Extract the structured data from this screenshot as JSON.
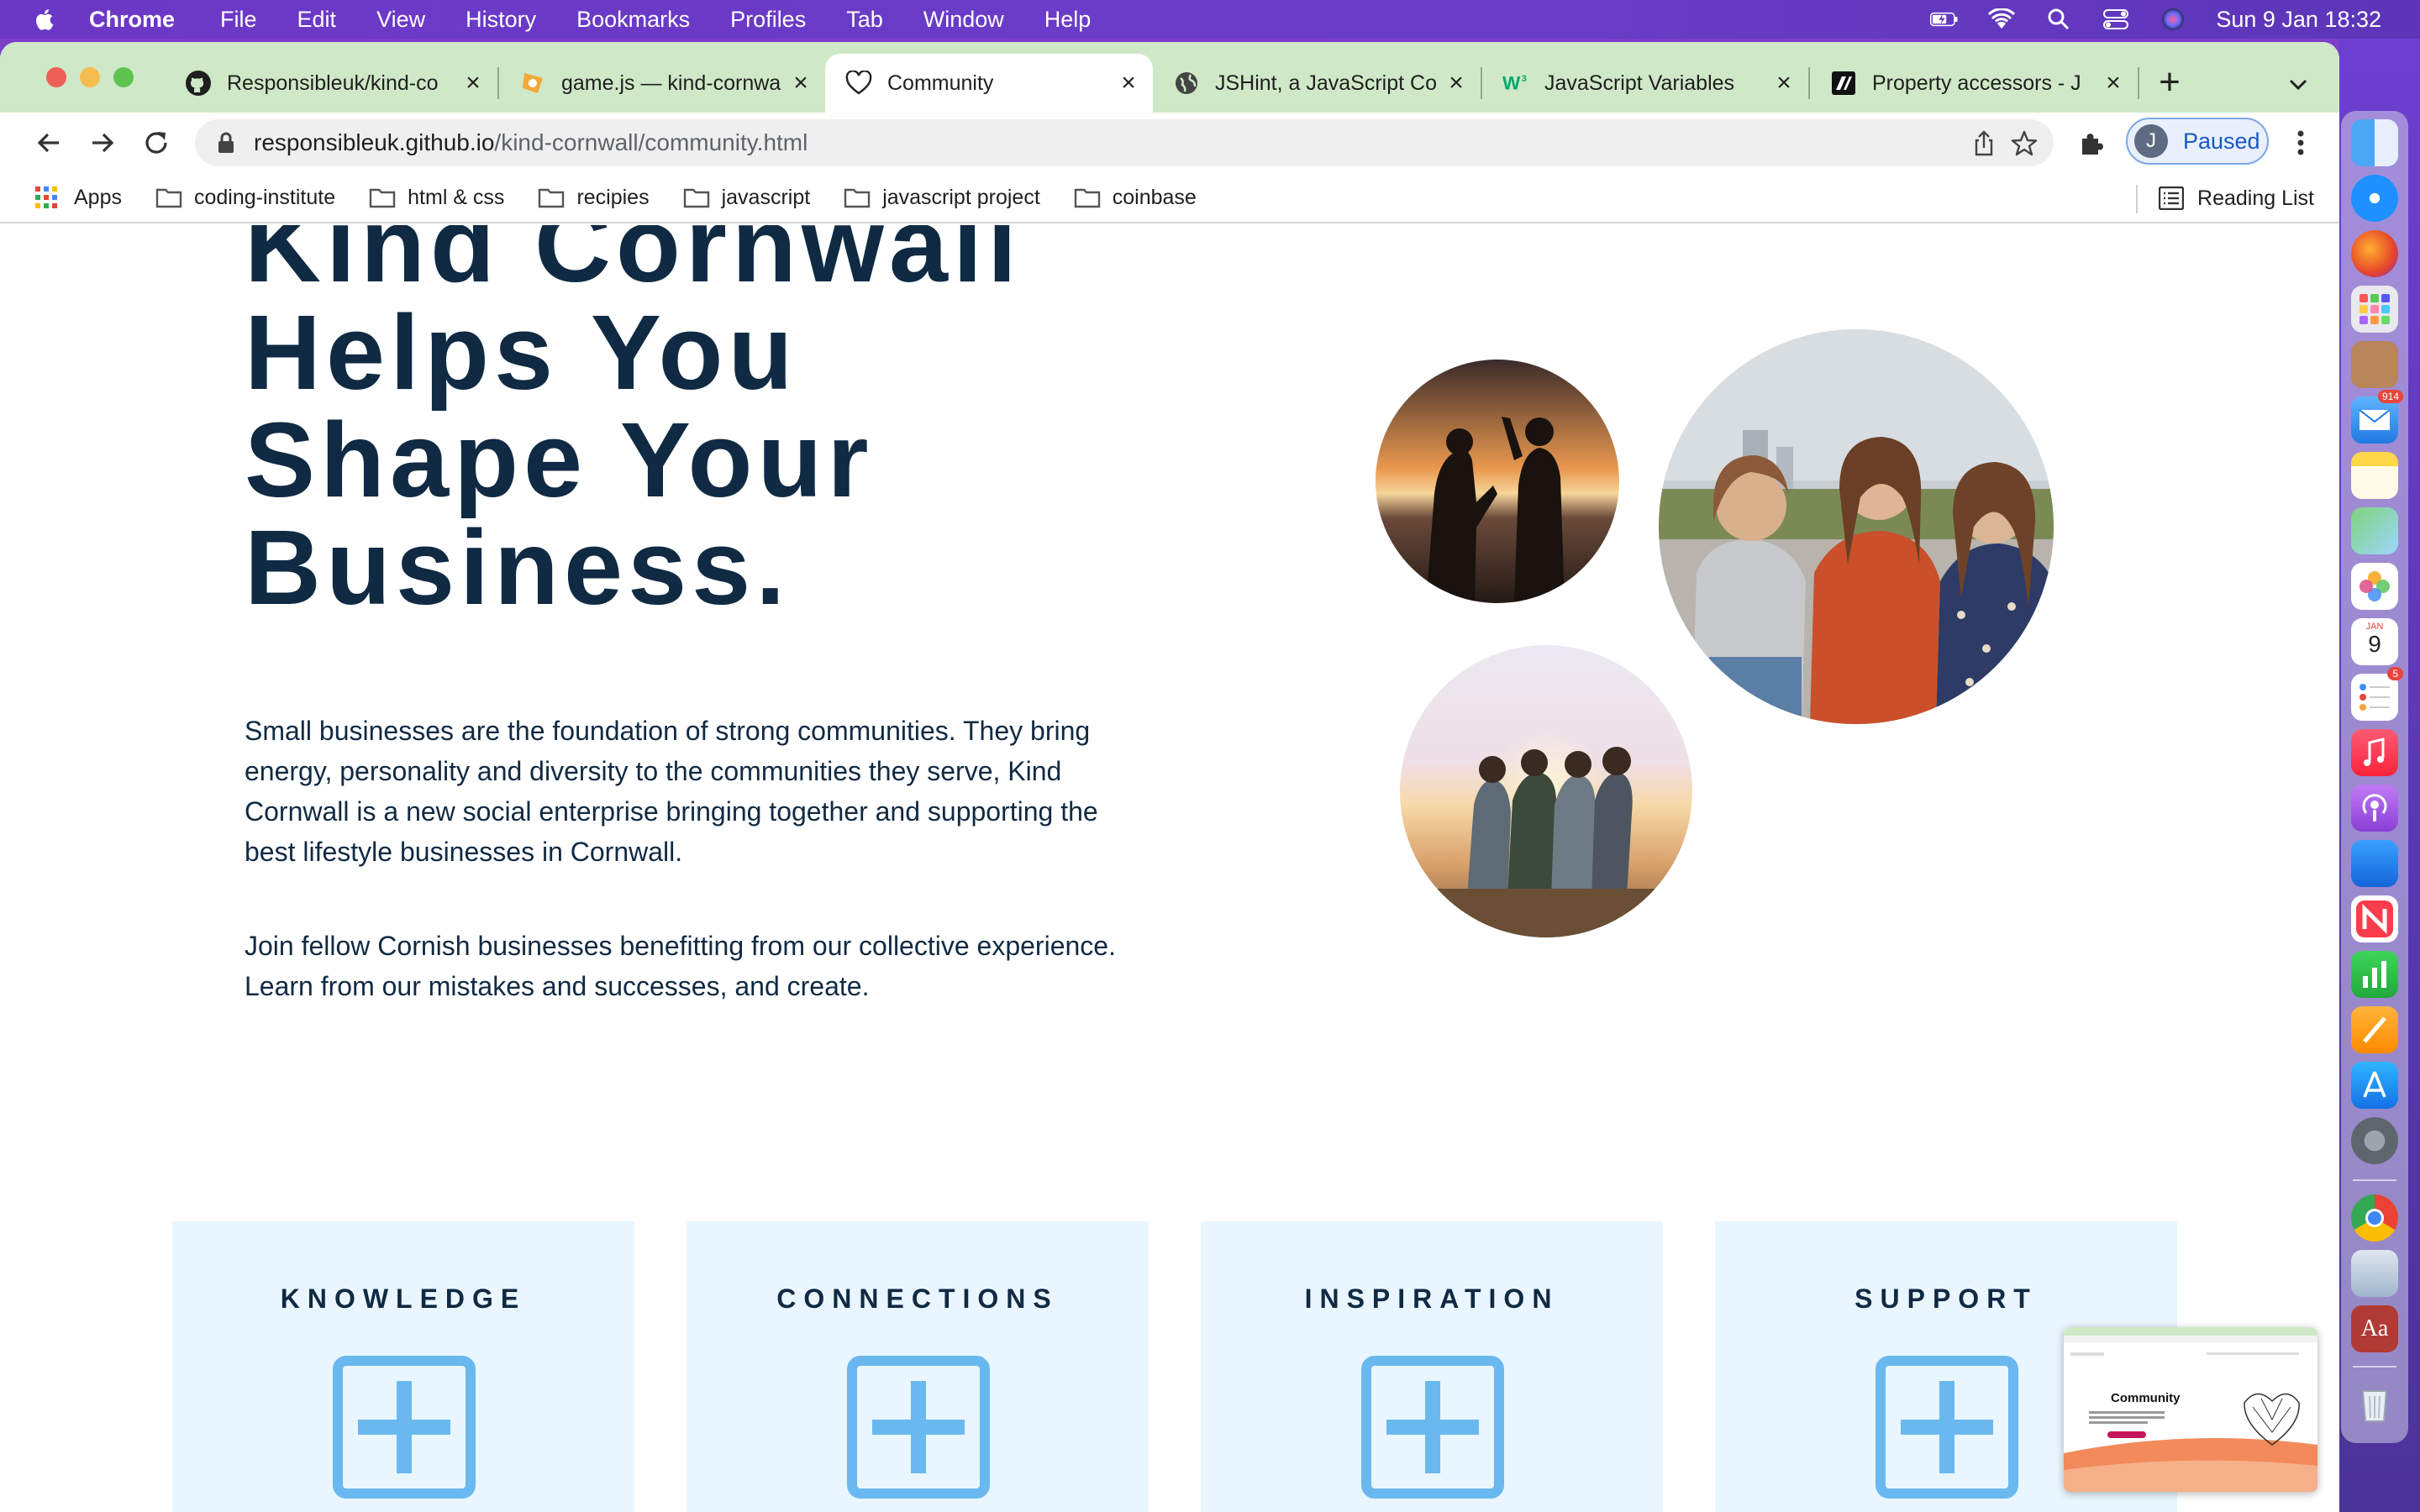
{
  "menubar": {
    "app_name": "Chrome",
    "items": [
      "File",
      "Edit",
      "View",
      "History",
      "Bookmarks",
      "Profiles",
      "Tab",
      "Window",
      "Help"
    ],
    "clock": "Sun 9 Jan  18:32"
  },
  "tabs": [
    {
      "title": "Responsibleuk/kind-co",
      "icon": "github-icon",
      "active": false
    },
    {
      "title": "game.js — kind-cornwa",
      "icon": "glitch-icon",
      "active": false
    },
    {
      "title": "Community",
      "icon": "heart-icon",
      "active": true
    },
    {
      "title": "JSHint, a JavaScript Co",
      "icon": "globe-icon",
      "active": false
    },
    {
      "title": "JavaScript Variables",
      "icon": "w3schools-icon",
      "active": false
    },
    {
      "title": "Property accessors - J",
      "icon": "mdn-icon",
      "active": false
    }
  ],
  "address_bar": {
    "host": "responsibleuk.github.io",
    "path": "/kind-cornwall/community.html"
  },
  "profile": {
    "initial": "J",
    "status": "Paused"
  },
  "bookmarks": {
    "apps_label": "Apps",
    "folders": [
      "coding-institute",
      "html & css",
      "recipies",
      "javascript",
      "javascript project",
      "coinbase"
    ],
    "reading_list": "Reading List"
  },
  "hero": {
    "title_lines": [
      "Kind Cornwall",
      "Helps You",
      "Shape Your",
      "Business."
    ],
    "paragraph1_lines": [
      "Small businesses are the foundation of strong communities. They bring",
      "energy, personality and diversity to the communities they serve, Kind",
      "Cornwall is a new social enterprise bringing together and supporting the",
      "best lifestyle businesses in Cornwall."
    ],
    "paragraph2_lines": [
      "Join fellow Cornish businesses benefitting from our collective experience.",
      "Learn from our mistakes and successes, and create."
    ]
  },
  "cards": [
    {
      "title": "KNOWLEDGE"
    },
    {
      "title": "CONNECTIONS"
    },
    {
      "title": "INSPIRATION"
    },
    {
      "title": "SUPPORT"
    }
  ],
  "pip_preview": {
    "title": "Community"
  },
  "dock": {
    "icons": [
      "finder-icon",
      "safari-icon",
      "firefox-icon",
      "launchpad-icon",
      "contacts-icon",
      "mail-icon",
      "notes-icon",
      "maps-icon",
      "photos-icon",
      "calendar-icon",
      "reminders-icon",
      "music-icon",
      "podcasts-icon",
      "keynote-icon",
      "news-icon",
      "numbers-icon",
      "pages-icon",
      "app-store-icon",
      "system-preferences-icon",
      "chrome-icon",
      "preview-icon",
      "dictionary-icon",
      "trash-icon"
    ],
    "mail_badge": "914",
    "reminders_badge": "5",
    "calendar_month": "JAN",
    "calendar_day": "9",
    "dictionary_label": "Aa"
  },
  "colors": {
    "heading": "#102a43",
    "card_bg": "#eaf6ff",
    "plus_icon": "#6ab8f0",
    "tabstrip": "#cfe8c7",
    "menubar": "#6b38c6"
  }
}
